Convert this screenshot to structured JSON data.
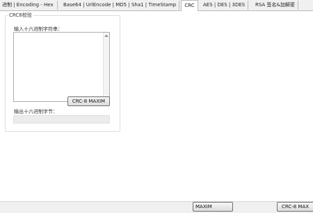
{
  "tabs": [
    {
      "label": "进制 | Encoding - Hex",
      "active": false
    },
    {
      "label": "Base64 | UrlEncode | MD5 | Sha1 | TimeStamp",
      "active": false
    },
    {
      "label": "CRC",
      "active": true
    },
    {
      "label": "AES | DES | 3DES",
      "active": false
    },
    {
      "label": "RSA 签名&加解密",
      "active": false
    }
  ],
  "crc_group": {
    "title": "CRC8校验",
    "input_label": "输入十六进制字符串：",
    "input_value": "",
    "button_label": "CRC-8 MAXIM",
    "output_label": "输出十六进制字节：",
    "output_value": ""
  },
  "bottom": {
    "button_left_label": "MAXIM",
    "button_right_label": "CRC-8 MAX"
  }
}
